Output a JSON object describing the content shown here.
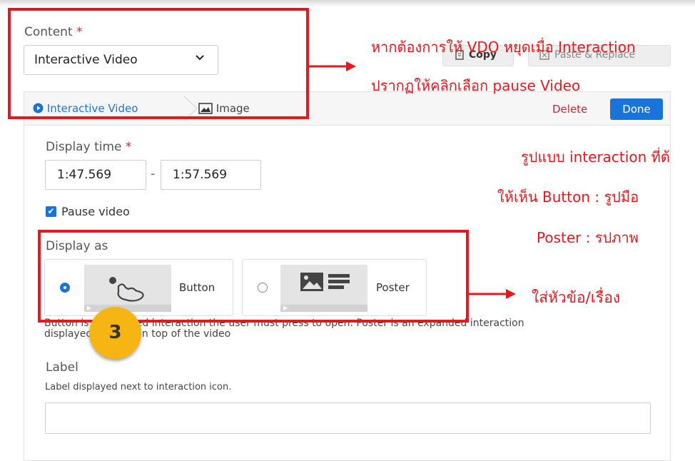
{
  "content": {
    "label": "Content",
    "required": "*",
    "selected": "Interactive Video"
  },
  "toolbar": {
    "copy_label": "Copy",
    "paste_label": "Paste & Replace"
  },
  "tabs": [
    {
      "label": "Interactive Video"
    },
    {
      "label": "Image"
    }
  ],
  "actions": {
    "delete_label": "Delete",
    "done_label": "Done"
  },
  "display_time": {
    "label": "Display time",
    "required": "*",
    "start": "1:47.569",
    "separator": "-",
    "end": "1:57.569"
  },
  "pause_video": {
    "label": "Pause video",
    "checked": true
  },
  "display_as": {
    "label": "Display as",
    "options": [
      {
        "label": "Button",
        "selected": true,
        "icon": "pointer-hand-icon"
      },
      {
        "label": "Poster",
        "selected": false,
        "icon": "image-text-icon"
      }
    ],
    "help_line1": "Button is a collapsed interaction the user must press to open. Poster is an expanded interaction",
    "help_line2": "displayed directly on top of the video"
  },
  "label_field": {
    "label": "Label",
    "help": "Label displayed next to interaction icon.",
    "value": ""
  },
  "annotations": {
    "note1_line1": "หากต้องการให้ VDO หยุดเมื่อ Interaction",
    "note1_line2": "ปรากฏให้คลิกเลือก pause Video",
    "note2_line1": "รูปแบบ interaction ที่ต้",
    "note2_line2": "ให้เห็น Button : รูปมือ",
    "note2_line3": "Poster : รปภาพ",
    "note3": "ใส่หัวข้อ/เรื่อง",
    "badge": "3"
  },
  "colors": {
    "accent": "#1a73d9",
    "annotation_red": "#e8171c",
    "badge": "#f7b514"
  }
}
